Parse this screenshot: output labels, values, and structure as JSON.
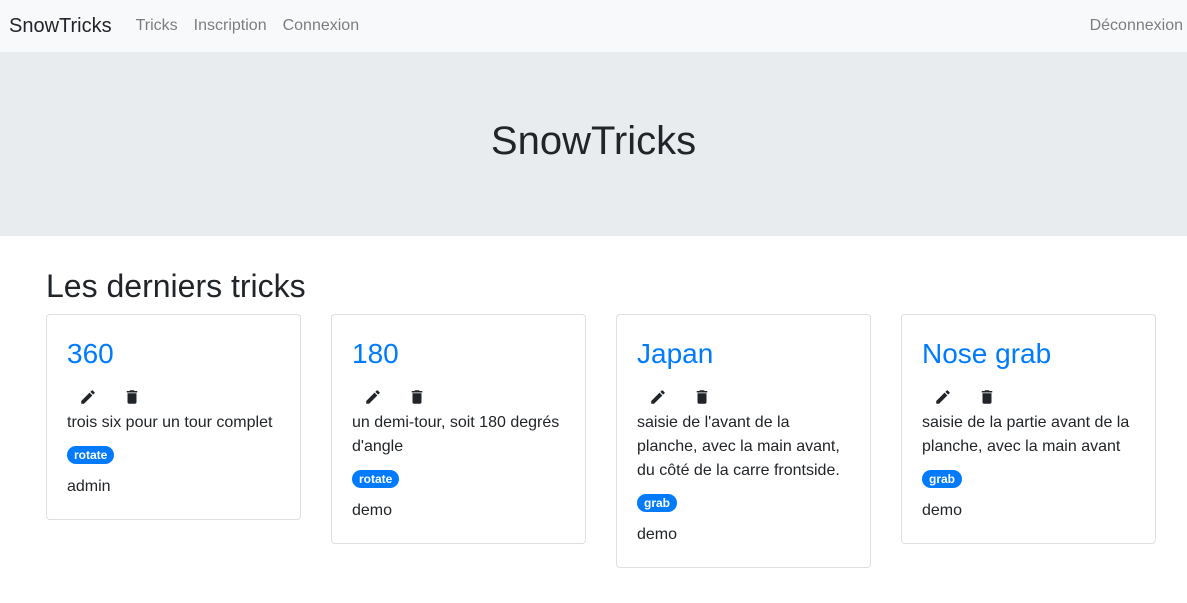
{
  "navbar": {
    "brand": "SnowTricks",
    "links": [
      "Tricks",
      "Inscription",
      "Connexion"
    ],
    "logout": "Déconnexion"
  },
  "hero": {
    "title": "SnowTricks"
  },
  "section": {
    "title": "Les derniers tricks"
  },
  "cards": [
    {
      "title": "360",
      "description": "trois six pour un tour complet",
      "tag": "rotate",
      "author": "admin"
    },
    {
      "title": "180",
      "description": "un demi-tour, soit 180 degrés d'angle",
      "tag": "rotate",
      "author": "demo"
    },
    {
      "title": "Japan",
      "description": "saisie de l'avant de la planche, avec la main avant, du côté de la carre frontside.",
      "tag": "grab",
      "author": "demo"
    },
    {
      "title": "Nose grab",
      "description": "saisie de la partie avant de la planche, avec la main avant",
      "tag": "grab",
      "author": "demo"
    }
  ],
  "icons": {
    "edit": "pencil-icon",
    "delete": "trash-icon"
  },
  "colors": {
    "accent": "#007bff",
    "navbar_bg": "#f8f9fa",
    "hero_bg": "#e9ecef"
  }
}
